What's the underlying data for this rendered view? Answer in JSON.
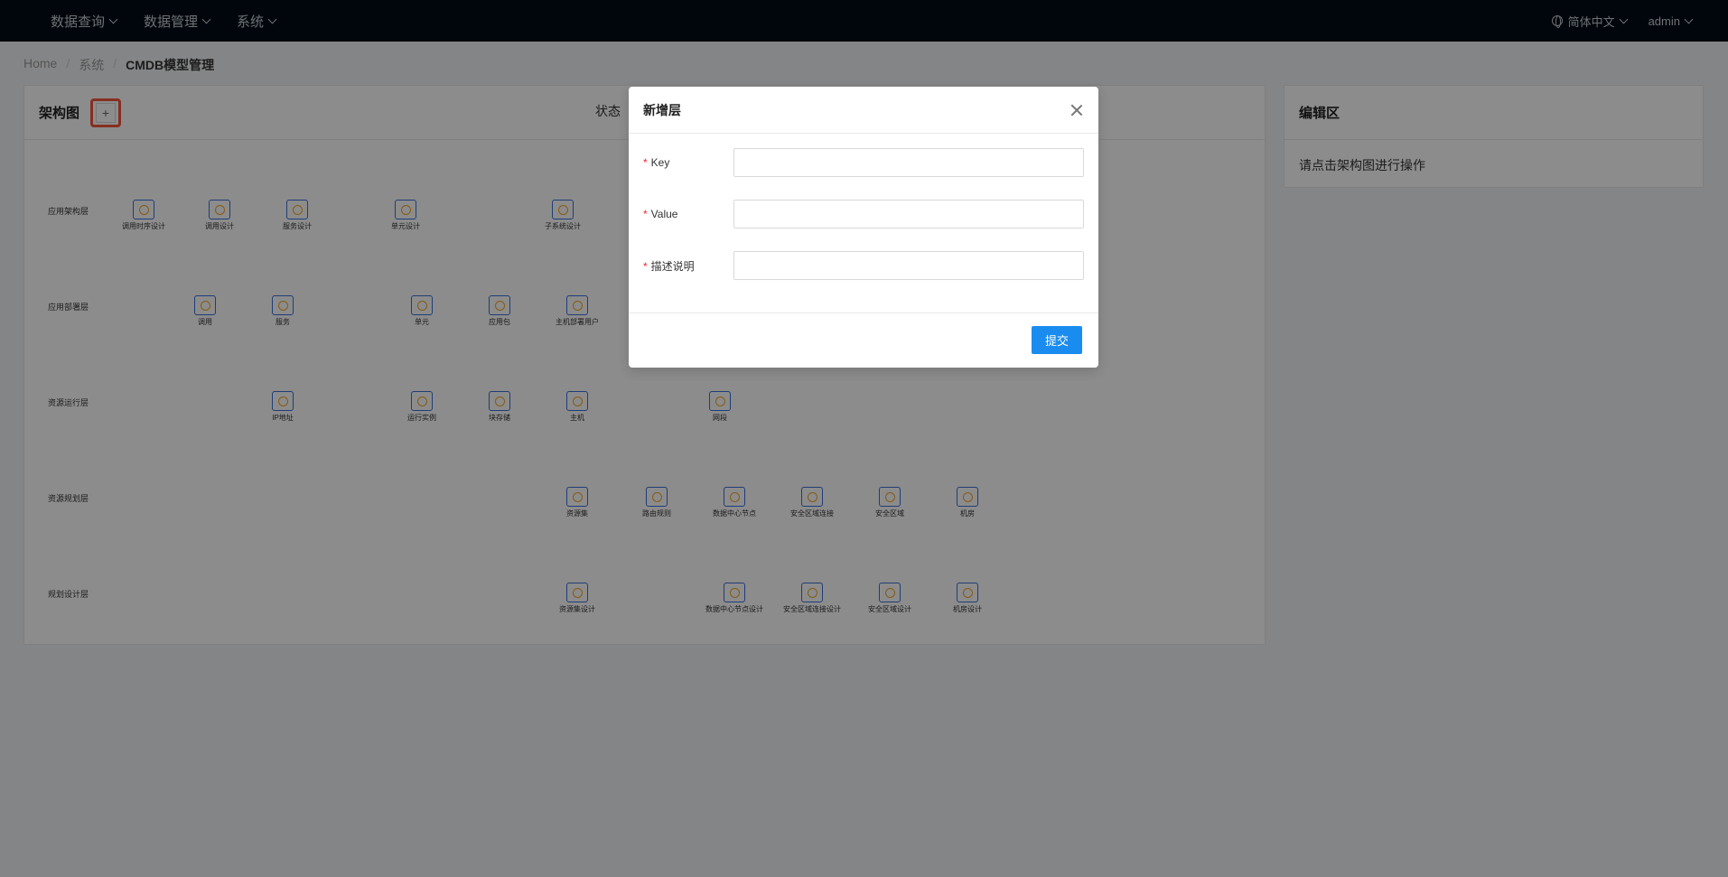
{
  "header": {
    "menu": [
      {
        "label": "数据查询"
      },
      {
        "label": "数据管理"
      },
      {
        "label": "系统"
      }
    ],
    "language": "简体中文",
    "user": "admin"
  },
  "breadcrumb": [
    "Home",
    "系统",
    "CMDB模型管理"
  ],
  "left_card": {
    "title": "架构图",
    "add_button": "+",
    "status_label": "状态"
  },
  "right_card": {
    "title": "编辑区",
    "hint": "请点击架构图进行操作"
  },
  "diagram": {
    "layers": [
      "应用架构层",
      "应用部署层",
      "资源运行层",
      "资源规划层",
      "规划设计层"
    ],
    "rows": [
      [
        "调用时序设计",
        "调用设计",
        "服务设计",
        "单元设计",
        "子系统设计"
      ],
      [
        "调用",
        "服务",
        "单元",
        "应用包",
        "主机部署用户"
      ],
      [
        "IP地址",
        "运行实例",
        "块存储",
        "主机",
        "网段"
      ],
      [
        "资源集",
        "路由规则",
        "数据中心节点",
        "安全区域连接",
        "安全区域",
        "机房"
      ],
      [
        "资源集设计",
        "数据中心节点设计",
        "安全区域连接设计",
        "安全区域设计",
        "机房设计"
      ]
    ]
  },
  "modal": {
    "title": "新增层",
    "fields": [
      {
        "label": "Key",
        "value": ""
      },
      {
        "label": "Value",
        "value": ""
      },
      {
        "label": "描述说明",
        "value": ""
      }
    ],
    "submit": "提交"
  }
}
